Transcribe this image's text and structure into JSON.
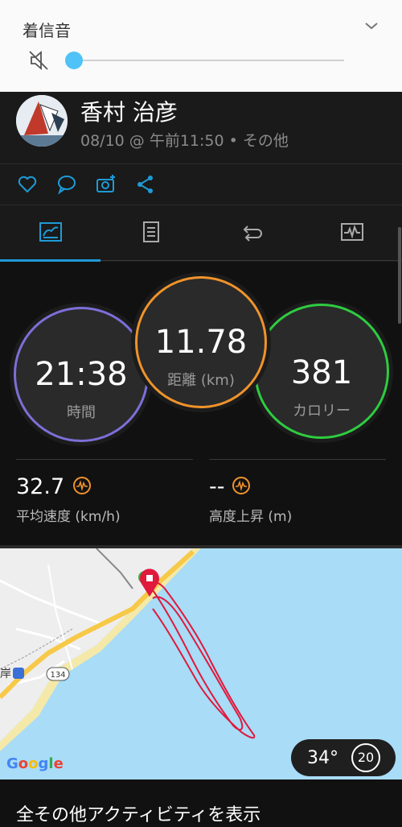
{
  "volume": {
    "title": "着信音",
    "level": 0.0
  },
  "header": {
    "name": "香村 治彦",
    "meta": "08/10 @ 午前11:50 • その他"
  },
  "stats": {
    "time": {
      "value": "21:38",
      "label": "時間"
    },
    "distance": {
      "value": "11.78",
      "label": "距離 (km)"
    },
    "calories": {
      "value": "381",
      "label": "カロリー"
    },
    "avg_speed": {
      "value": "32.7",
      "label": "平均速度 (km/h)"
    },
    "elev_gain": {
      "value": "--",
      "label": "高度上昇 (m)"
    }
  },
  "map": {
    "road_number": "134",
    "station_char": "岸",
    "temperature": "34°",
    "wind": "20",
    "attribution": {
      "G": "G",
      "o1": "o",
      "o2": "o",
      "g": "g",
      "l": "l",
      "e": "e"
    }
  },
  "footer": {
    "link": "全その他アクティビティを表示"
  },
  "colors": {
    "accent": "#1e9bd7",
    "time_ring": "#7c6fd8",
    "distance_ring": "#f0932b",
    "calories_ring": "#2ecc40",
    "track": "#e0193d",
    "water": "#a8dcf7"
  }
}
